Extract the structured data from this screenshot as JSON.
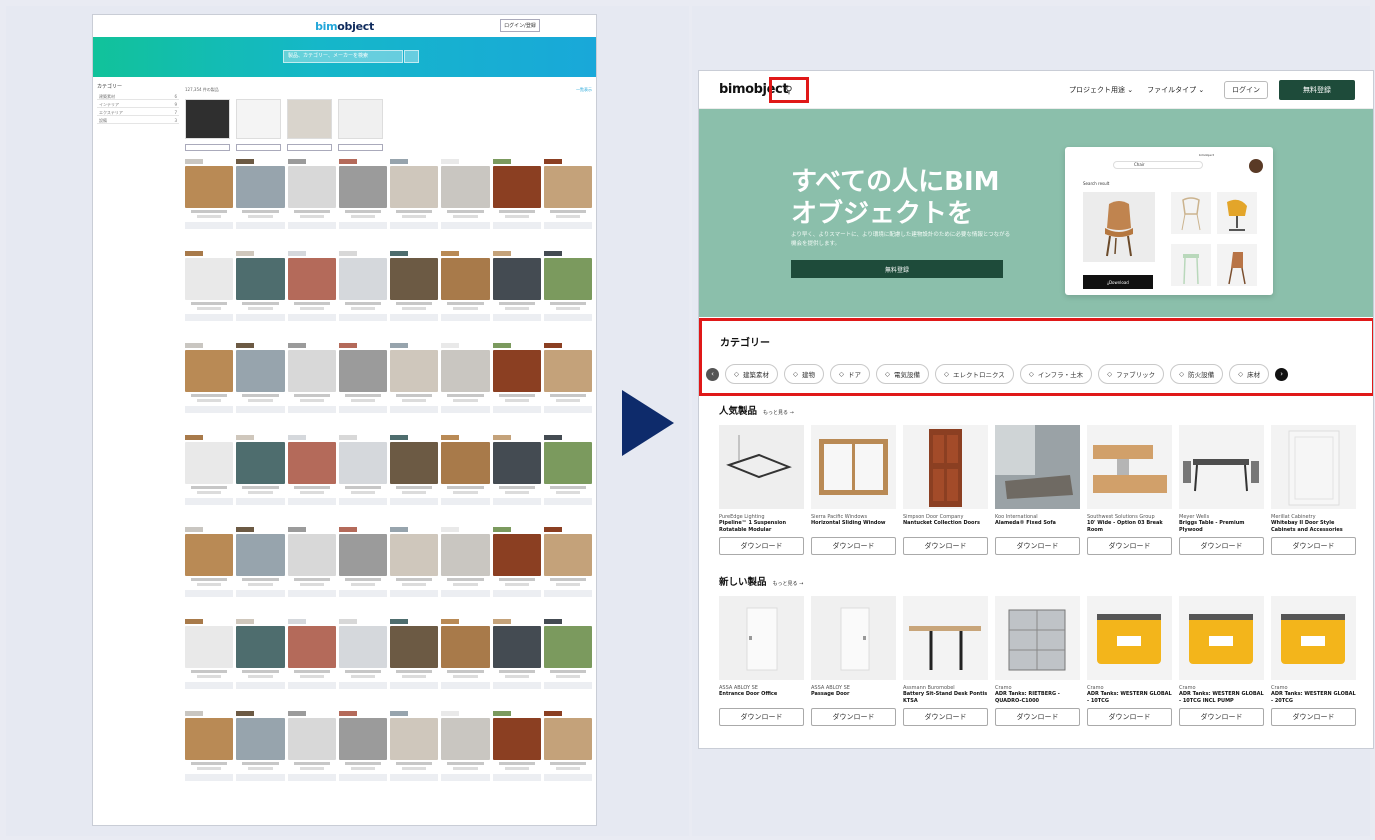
{
  "old_site": {
    "logo_a": "bim",
    "logo_b": "object",
    "login_label": "ログイン/登録",
    "search_placeholder": "製品、カテゴリー、メーカーを検索",
    "sidebar_title": "カテゴリー",
    "sidebar_rows": [
      {
        "label": "建築素材",
        "count": "6"
      },
      {
        "label": "インテリア",
        "count": "9"
      },
      {
        "label": "エクステリア",
        "count": "7"
      },
      {
        "label": "設備",
        "count": "3"
      }
    ],
    "count_text": "127,354 件の製品",
    "view_text": "一覧表示"
  },
  "new_site": {
    "logo": "bimobject",
    "search_icon": "search-icon",
    "nav": [
      "プロジェクト用途 ⌄",
      "ファイルタイプ ⌄"
    ],
    "login": "ログイン",
    "signup": "無料登録",
    "hero": {
      "title": "すべての人にBIMオブジェクトを",
      "subtitle": "より早く、よりスマートに、より環境に配慮した建物設計のために必要な情報とつながる機会を提供します。",
      "cta": "無料登録",
      "mock_logo": "bimobject",
      "mock_search": "Chair",
      "mock_result": "Search result",
      "mock_download": "Download"
    },
    "categories": {
      "title": "カテゴリー",
      "items": [
        "建築素材",
        "建物",
        "ドア",
        "電気設備",
        "エレクトロニクス",
        "インフラ・土木",
        "ファブリック",
        "防火設備",
        "床材"
      ]
    },
    "popular": {
      "title": "人気製品",
      "more": "もっと見る →",
      "items": [
        {
          "brand": "PureEdge Lighting",
          "name": "Pipeline™ 1 Suspension Rotatable Modular",
          "download": "ダウンロード"
        },
        {
          "brand": "Sierra Pacific Windows",
          "name": "Horizontal Sliding Window",
          "download": "ダウンロード"
        },
        {
          "brand": "Simpson Door Company",
          "name": "Nantucket Collection Doors",
          "download": "ダウンロード"
        },
        {
          "brand": "Koo International",
          "name": "Alameda® Fixed Sofa",
          "download": "ダウンロード"
        },
        {
          "brand": "Southwest Solutions Group",
          "name": "10' Wide - Option 03 Break Room",
          "download": "ダウンロード"
        },
        {
          "brand": "Meyer Wells",
          "name": "Briggs Table - Premium Plywood",
          "download": "ダウンロード"
        },
        {
          "brand": "Merillat Cabinetry",
          "name": "Whitebay II Door Style Cabinets and Accessories",
          "download": "ダウンロード"
        }
      ]
    },
    "new_products": {
      "title": "新しい製品",
      "more": "もっと見る →",
      "items": [
        {
          "brand": "ASSA ABLOY SE",
          "name": "Entrance Door Office",
          "download": "ダウンロード"
        },
        {
          "brand": "ASSA ABLOY SE",
          "name": "Passage Door",
          "download": "ダウンロード"
        },
        {
          "brand": "Assmann Buromobel",
          "name": "Battery Sit-Stand Desk Pontis KTSA",
          "download": "ダウンロード"
        },
        {
          "brand": "Cramo",
          "name": "ADR Tanks: RIETBERG - QUADRO-C1000",
          "download": "ダウンロード"
        },
        {
          "brand": "Cramo",
          "name": "ADR Tanks: WESTERN GLOBAL - 10TCG",
          "download": "ダウンロード"
        },
        {
          "brand": "Cramo",
          "name": "ADR Tanks: WESTERN GLOBAL - 10TCG INCL PUMP",
          "download": "ダウンロード"
        },
        {
          "brand": "Cramo",
          "name": "ADR Tanks: WESTERN GLOBAL - 20TCG",
          "download": "ダウンロード"
        }
      ]
    }
  },
  "colors": {
    "hero_green": "#8bbfab",
    "dark_green": "#1e4b3a",
    "highlight_red": "#e01818",
    "arrow_navy": "#0e2b6b",
    "old_accent": "#19a8d9"
  }
}
